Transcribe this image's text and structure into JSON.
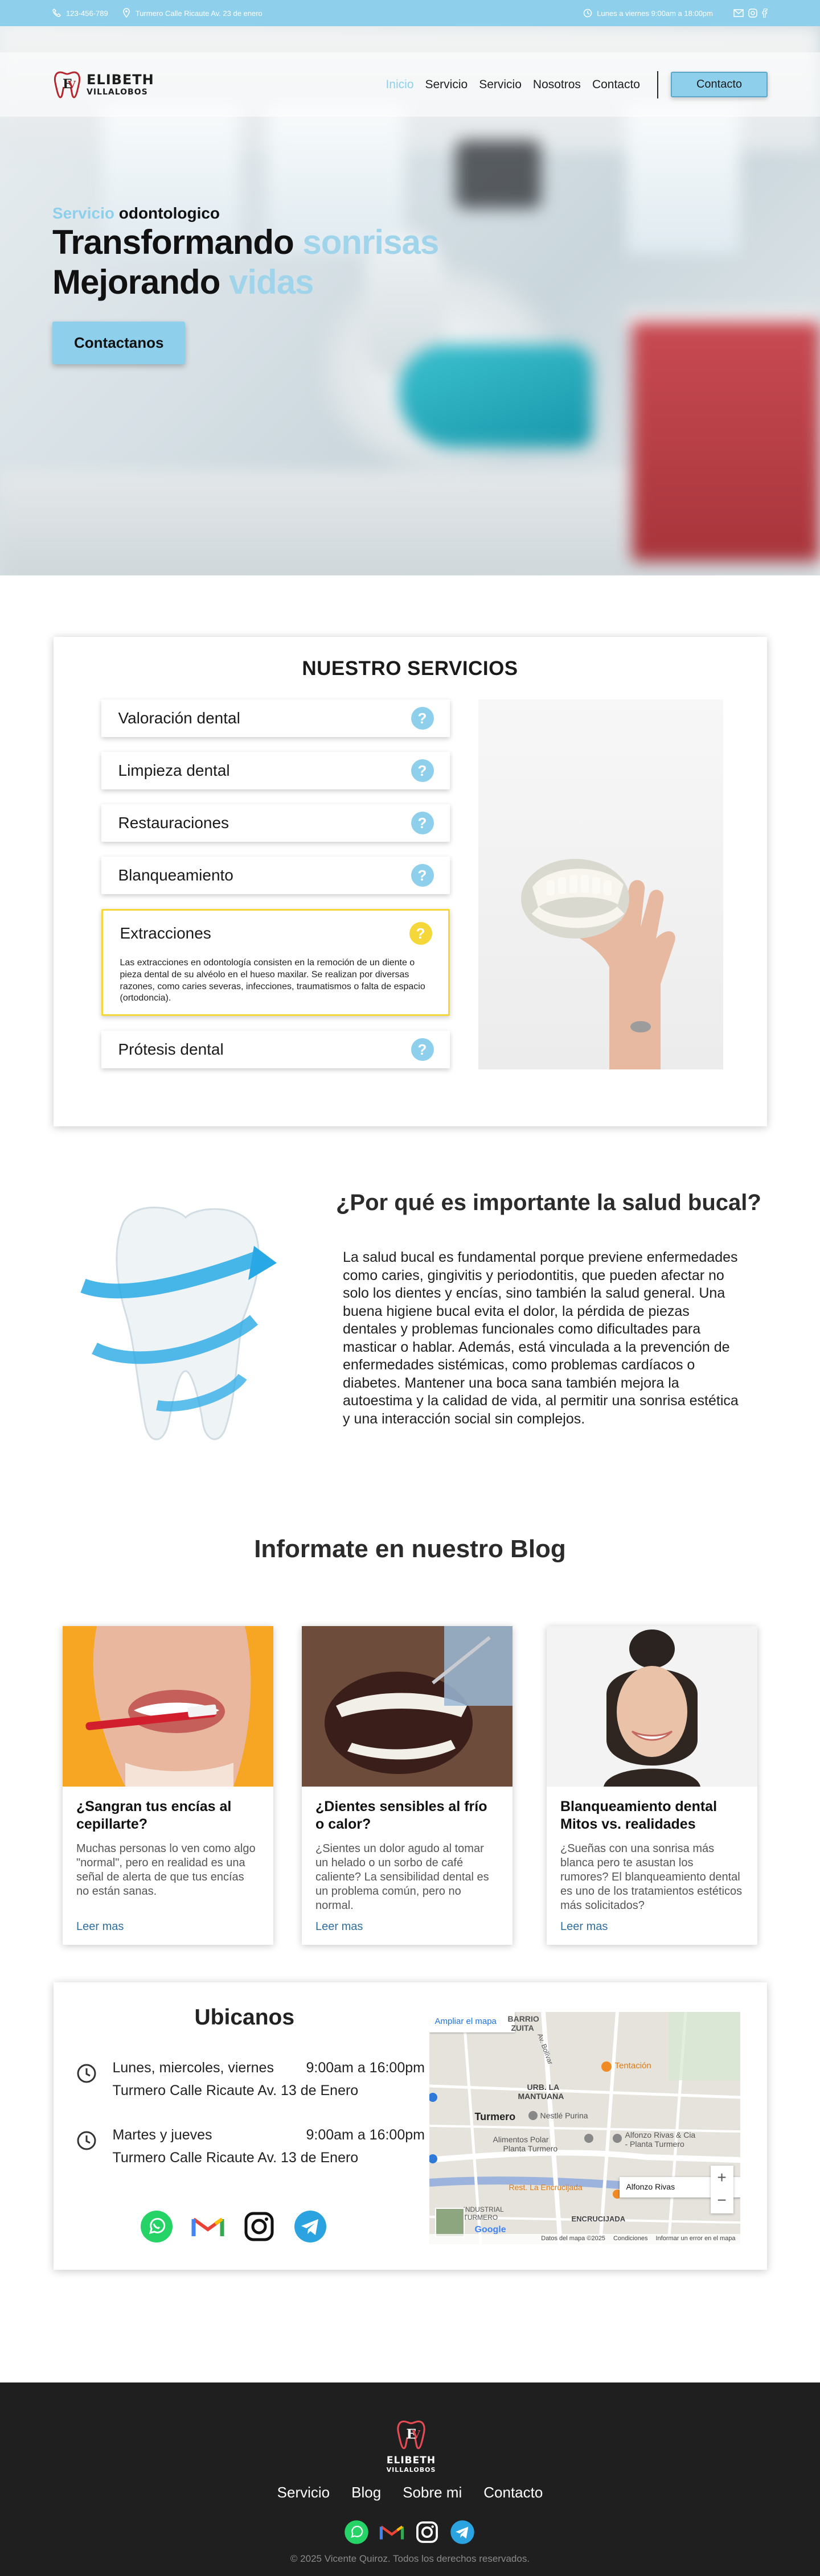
{
  "topbar": {
    "phone": "123-456-789",
    "address": "Turmero Calle Ricaute Av. 23 de enero",
    "hours": "Lunes a viernes 9:00am a 18:00pm"
  },
  "header": {
    "logo_line1": "ELIBETH",
    "logo_line2": "VILLALOBOS",
    "nav": [
      "Inicio",
      "Servicio",
      "Servicio",
      "Nosotros",
      "Contacto"
    ],
    "cta": "Contacto"
  },
  "hero": {
    "sub_accent": "Servicio",
    "sub_rest": "odontologico",
    "line1_main": "Transformando",
    "line1_accent": "sonrisas",
    "line2_main": "Mejorando",
    "line2_accent": "vidas",
    "button": "Contactanos"
  },
  "services": {
    "title": "NUESTRO SERVICIOS",
    "items": [
      {
        "name": "Valoración dental",
        "q": "?"
      },
      {
        "name": "Limpieza dental",
        "q": "?"
      },
      {
        "name": "Restauraciones",
        "q": "?"
      },
      {
        "name": "Blanqueamiento",
        "q": "?"
      },
      {
        "name": "Extracciones",
        "q": "?",
        "desc": "Las extracciones en odontología consisten en la remoción de un diente o pieza dental de su alvéolo en el hueso maxilar. Se realizan por diversas razones, como caries severas, infecciones, traumatismos o falta de espacio (ortodoncia)."
      },
      {
        "name": "Prótesis dental",
        "q": "?"
      }
    ]
  },
  "why": {
    "title": "¿Por qué es importante la salud bucal?",
    "text": "La salud bucal es fundamental porque previene enfermedades como caries, gingivitis y periodontitis, que pueden afectar no solo los dientes y encías, sino también la salud general. Una buena higiene bucal evita el dolor, la pérdida de piezas dentales y problemas funcionales como dificultades para masticar o hablar. Además, está vinculada a la prevención de enfermedades sistémicas, como problemas cardíacos o diabetes. Mantener una boca sana también mejora la autoestima y la calidad de vida, al permitir una sonrisa estética y una interacción social sin complejos."
  },
  "blog": {
    "title": "Informate en nuestro Blog",
    "cards": [
      {
        "title": "¿Sangran tus encías al cepillarte?",
        "text": "Muchas personas lo ven como algo \"normal\", pero en realidad es una señal de alerta de que tus encías no están sanas.",
        "more": "Leer mas"
      },
      {
        "title": "¿Dientes sensibles al frío o calor?",
        "text": "¿Sientes un dolor agudo al tomar un helado o un sorbo de café caliente? La sensibilidad dental es un problema común, pero no normal.",
        "more": "Leer mas"
      },
      {
        "title": "Blanqueamiento dental Mitos vs. realidades",
        "text": "¿Sueñas con una sonrisa más blanca pero te asustan los rumores? El blanqueamiento dental es uno de los tratamientos estéticos más solicitados?",
        "more": "Leer mas"
      }
    ]
  },
  "location": {
    "title": "Ubicanos",
    "block1_days": "Lunes, miercoles, viernes",
    "block1_hours": "9:00am a 16:00pm",
    "block1_address": "Turmero Calle Ricaute Av. 13 de Enero",
    "block2_days": "Martes y jueves",
    "block2_hours": "9:00am a 16:00pm",
    "block2_address": "Turmero Calle Ricaute Av. 13 de Enero",
    "map": {
      "enlarge": "Ampliar el mapa",
      "labels": [
        "BARRIO",
        "ZUITA",
        "Av. Bolívar",
        "Tentación",
        "URB. LA",
        "MANTUANA",
        "Turmero",
        "Nestlé Purina",
        "Alimentos Polar",
        "Planta Turmero",
        "Alfonzo Rivas & Cia",
        "- Planta Turmero",
        "Rest. La Encrucijada",
        "Alfonzo Rivas",
        "ENCRUCIJADA",
        "INDUSTRIAL",
        "TURMERO"
      ],
      "footer": [
        "Datos del mapa ©2025",
        "Condiciones",
        "Informar un error en el mapa"
      ],
      "brand": "Google"
    }
  },
  "footer": {
    "logo_line1": "ELIBETH",
    "logo_line2": "VILLALOBOS",
    "nav": [
      "Servicio",
      "Blog",
      "Sobre mi",
      "Contacto"
    ],
    "copyright": "© 2025 Vicente Quiroz. Todos los derechos reservados."
  },
  "colors": {
    "accent": "#8ed0ec",
    "highlight": "#f5d73a",
    "footer_bg": "#1f1f1f"
  }
}
